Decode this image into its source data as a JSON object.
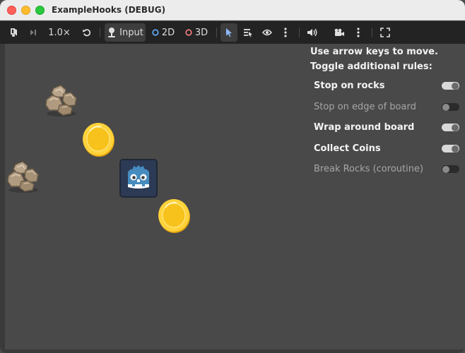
{
  "window": {
    "title": "ExampleHooks (DEBUG)"
  },
  "toolbar": {
    "speed_label": "1.0×",
    "input_label": "Input",
    "mode_2d_label": "2D",
    "mode_3d_label": "3D"
  },
  "instructions": {
    "line1": "Use arrow keys to move.",
    "line2": "Toggle additional rules:"
  },
  "rules": [
    {
      "label": "Stop on rocks",
      "enabled": true
    },
    {
      "label": "Stop on edge of board",
      "enabled": false
    },
    {
      "label": "Wrap around board",
      "enabled": true
    },
    {
      "label": "Collect Coins",
      "enabled": true
    },
    {
      "label": "Break Rocks (coroutine)",
      "enabled": false
    }
  ],
  "board": {
    "sprites": [
      "rock-icon",
      "coin-icon",
      "rock-icon",
      "godot-player-icon",
      "coin-icon"
    ]
  },
  "colors": {
    "accent_2d": "#5fb2ff",
    "accent_3d": "#fc7f7f",
    "select_blue": "#8fb8ff"
  }
}
